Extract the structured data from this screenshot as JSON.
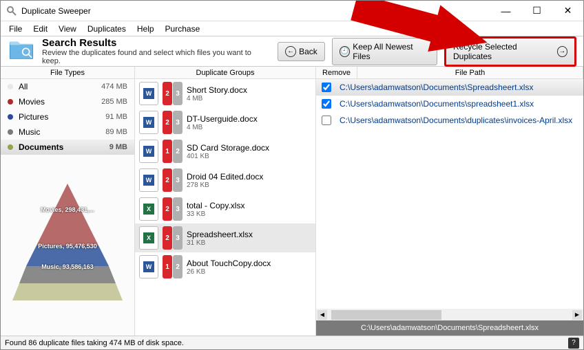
{
  "window": {
    "title": "Duplicate Sweeper"
  },
  "menu": {
    "file": "File",
    "edit": "Edit",
    "view": "View",
    "duplicates": "Duplicates",
    "help": "Help",
    "purchase": "Purchase"
  },
  "header": {
    "title": "Search Results",
    "subtitle": "Review the duplicates found and select which files you want to keep.",
    "back": "Back",
    "keep": "Keep All Newest Files",
    "recycle": "Recycle Selected Duplicates"
  },
  "columns": {
    "filetypes": "File Types",
    "groups": "Duplicate Groups",
    "remove": "Remove",
    "filepath": "File Path"
  },
  "filetypes": [
    {
      "label": "All",
      "size": "474 MB",
      "color": "#e8e8e8"
    },
    {
      "label": "Movies",
      "size": "285 MB",
      "color": "#b02a2a"
    },
    {
      "label": "Pictures",
      "size": "91 MB",
      "color": "#2a4aa0"
    },
    {
      "label": "Music",
      "size": "89 MB",
      "color": "#7a7a7a"
    },
    {
      "label": "Documents",
      "size": "9 MB",
      "color": "#9aa050"
    }
  ],
  "pyramid": {
    "movies": "Movies, 298,431,...",
    "pictures": "Pictures, 95,476,530",
    "music": "Music, 93,586,163"
  },
  "groups": [
    {
      "name": "Short Story.docx",
      "size": "4 MB",
      "app": "word",
      "b1": "2",
      "b2": "3"
    },
    {
      "name": "DT-Userguide.docx",
      "size": "4 MB",
      "app": "word",
      "b1": "2",
      "b2": "3"
    },
    {
      "name": "SD Card Storage.docx",
      "size": "401 KB",
      "app": "word",
      "b1": "1",
      "b2": "2"
    },
    {
      "name": "Droid 04 Edited.docx",
      "size": "278 KB",
      "app": "word",
      "b1": "2",
      "b2": "3"
    },
    {
      "name": "total - Copy.xlsx",
      "size": "33 KB",
      "app": "excel",
      "b1": "2",
      "b2": "3"
    },
    {
      "name": "Spreadsheert.xlsx",
      "size": "31 KB",
      "app": "excel",
      "b1": "2",
      "b2": "3"
    },
    {
      "name": "About TouchCopy.docx",
      "size": "26 KB",
      "app": "word",
      "b1": "1",
      "b2": "2"
    }
  ],
  "files": [
    {
      "checked": true,
      "path": "C:\\Users\\adamwatson\\Documents\\Spreadsheert.xlsx",
      "sel": true
    },
    {
      "checked": true,
      "path": "C:\\Users\\adamwatson\\Documents\\spreadsheet1.xlsx",
      "sel": false
    },
    {
      "checked": false,
      "path": "C:\\Users\\adamwatson\\Documents\\duplicates\\invoices-April.xlsx",
      "sel": false
    }
  ],
  "footerpath": "C:\\Users\\adamwatson\\Documents\\Spreadsheert.xlsx",
  "status": "Found 86 duplicate files taking 474 MB of disk space."
}
